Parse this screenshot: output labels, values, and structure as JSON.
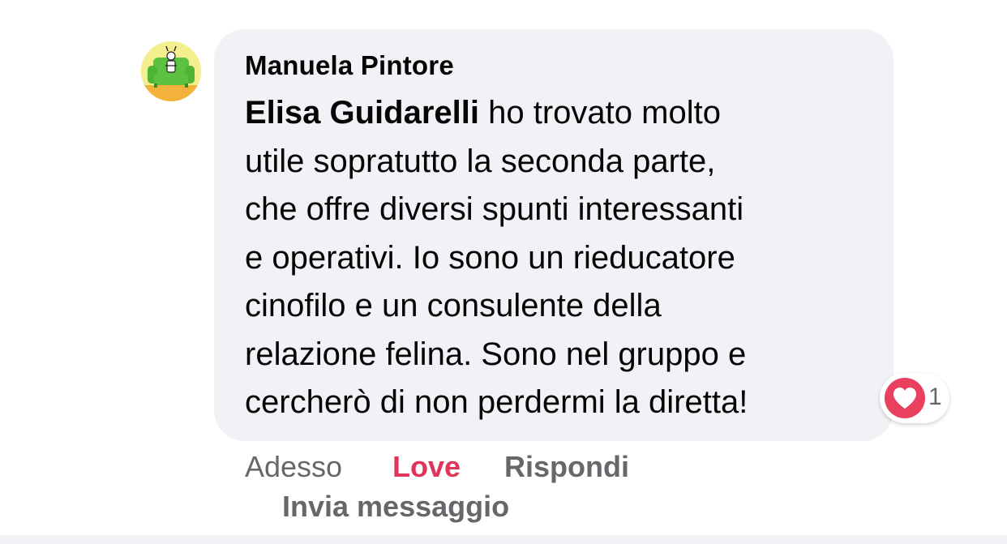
{
  "comment": {
    "author": "Manuela Pintore",
    "mention": "Elisa Guidarelli",
    "text_lines": [
      " ho trovato molto",
      "utile sopratutto la seconda parte,",
      "che offre diversi spunti interessanti",
      "e operativi. Io sono un rieducatore",
      "cinofilo e un consulente della",
      "relazione felina. Sono nel gruppo e",
      "cercherò di non perdermi la diretta!"
    ],
    "reaction": {
      "icon": "heart-icon",
      "count": "1",
      "color": "#e8405e"
    }
  },
  "actions": {
    "timestamp": "Adesso",
    "love_label": "Love",
    "reply_label": "Rispondi",
    "message_label": "Invia messaggio"
  },
  "colors": {
    "bubble": "#f0f2f5",
    "love": "#e0355b",
    "secondary_text": "#65676b"
  }
}
